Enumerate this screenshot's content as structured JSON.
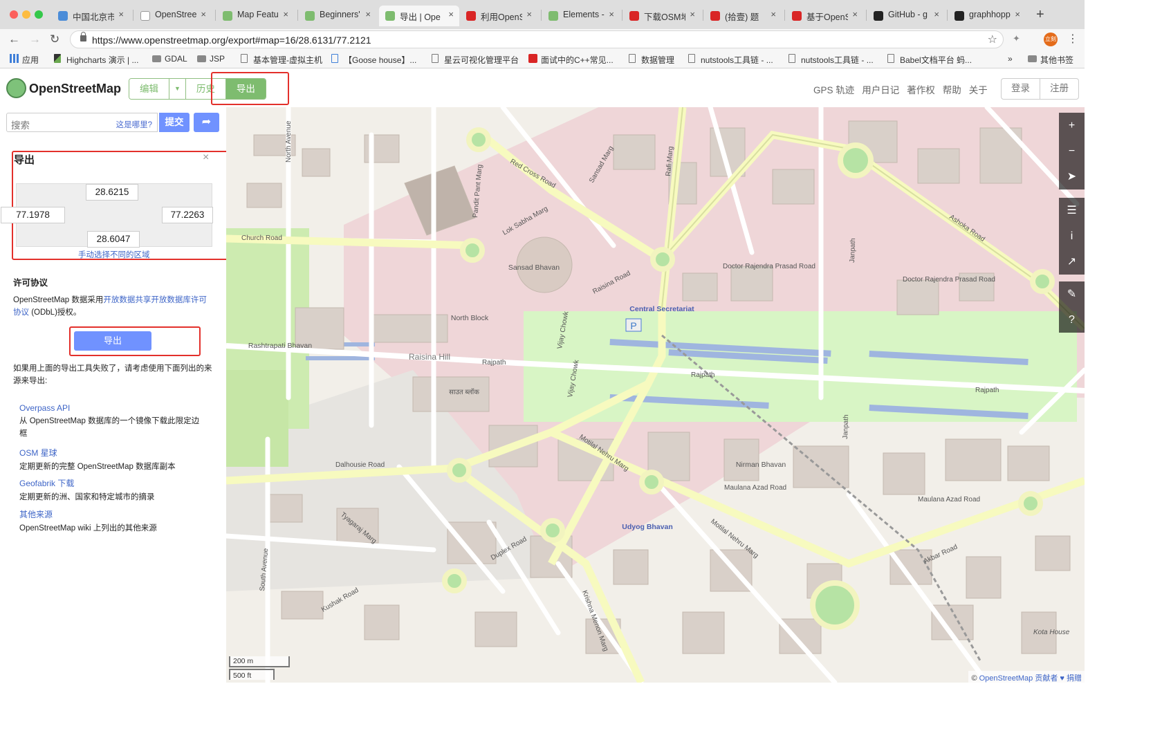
{
  "browser": {
    "tabs": [
      {
        "label": "中国北京市",
        "fav": "#4a8cd8"
      },
      {
        "label": "OpenStree",
        "fav": "#ffffff"
      },
      {
        "label": "Map Featur",
        "fav": "#7ebc6f"
      },
      {
        "label": "Beginners'",
        "fav": "#7ebc6f"
      },
      {
        "label": "导出 | Ope",
        "fav": "#7ebc6f"
      },
      {
        "label": "利用OpenS",
        "fav": "#d92525"
      },
      {
        "label": "Elements -",
        "fav": "#7ebc6f"
      },
      {
        "label": "下载OSM地",
        "fav": "#d92525"
      },
      {
        "label": "(拾壹) 题",
        "fav": "#d92525"
      },
      {
        "label": "基于OpenS",
        "fav": "#d92525"
      },
      {
        "label": "GitHub - g",
        "fav": "#222222"
      },
      {
        "label": "graphhopp",
        "fav": "#222222"
      }
    ],
    "active_tab": 4,
    "url": "https://www.openstreetmap.org/export#map=16/28.6131/77.2121",
    "avatar_text": "立刻",
    "bookmarks": [
      {
        "label": "应用",
        "icon": "apps-grid-icon"
      },
      {
        "label": "Highcharts 演示 | ...",
        "icon": "highcharts-icon"
      },
      {
        "label": "GDAL",
        "icon": "folder-icon"
      },
      {
        "label": "JSP",
        "icon": "folder-icon"
      },
      {
        "label": "基本管理-虚拟主机",
        "icon": "page-icon"
      },
      {
        "label": "【Goose house】...",
        "icon": "calendar-icon"
      },
      {
        "label": "星云可视化管理平台",
        "icon": "page-icon"
      },
      {
        "label": "面试中的C++常见...",
        "icon": "csdn-icon"
      },
      {
        "label": "数据管理",
        "icon": "page-icon"
      },
      {
        "label": "nutstools工具链 - ...",
        "icon": "page-icon"
      },
      {
        "label": "nutstools工具链 - ...",
        "icon": "page-icon"
      },
      {
        "label": "Babel文档平台 蚂...",
        "icon": "page-icon"
      }
    ],
    "bookmarks_more": "»",
    "other_bookmarks": "其他书签"
  },
  "osm": {
    "logo_text": "OpenStreetMap",
    "edit_label": "编辑",
    "history_label": "历史",
    "export_label": "导出",
    "nav_links": [
      "GPS 轨迹",
      "用户日记",
      "著作权",
      "帮助",
      "关于"
    ],
    "login_label": "登录",
    "signup_label": "注册",
    "accent_color": "#7ebc6f"
  },
  "sidebar": {
    "search_placeholder": "搜索",
    "where_is_this": "这是哪里?",
    "submit_label": "提交",
    "export_title": "导出",
    "bbox": {
      "north": "28.6215",
      "west": "77.1978",
      "east": "77.2263",
      "south": "28.6047"
    },
    "manual_select": "手动选择不同的区域",
    "license_heading": "许可协议",
    "license_prefix": "OpenStreetMap 数据采用",
    "license_link": "开放数据共享开放数据库许可协议",
    "license_suffix": " (ODbL)授权。",
    "export_button": "导出",
    "fallback_text": "如果用上面的导出工具失败了，请考虑使用下面列出的来源来导出:",
    "sources": [
      {
        "name": "Overpass API",
        "desc": "从 OpenStreetMap 数据库的一个镜像下载此限定边框"
      },
      {
        "name": "OSM 星球",
        "desc": "定期更新的完整 OpenStreetMap 数据库副本"
      },
      {
        "name": "Geofabrik 下载",
        "desc": "定期更新的洲、国家和特定城市的摘录"
      },
      {
        "name": "其他来源",
        "desc": "OpenStreetMap wiki 上列出的其他来源"
      }
    ]
  },
  "map": {
    "scale_metric": "200 m",
    "scale_imperial": "500 ft",
    "attribution_prefix": "© ",
    "attribution_link": "OpenStreetMap 贡献者",
    "attribution_donate": " ♥ 捐赠",
    "labels": {
      "sansad_bhavan": "Sansad Bhavan",
      "central_secretariat": "Central Secretariat",
      "rashtrapati_bhavan": "Rashtrapati Bhavan",
      "raisina_hill": "Raisina Hill",
      "north_block": "North Block",
      "nirman_bhavan": "Nirman Bhavan",
      "udyog_bhavan": "Udyog Bhavan",
      "rajpath": "Rajpath",
      "dalhousie_road": "Dalhousie Road",
      "church_road": "Church Road",
      "ashoka_road": "Ashoka Road",
      "raisina_road": "Raisina Road",
      "maulana_azad_road": "Maulana Azad Road",
      "dr_rajendra_prasad_road": "Doctor Rajendra Prasad Road",
      "vijay_chowk": "Vijay Chowk",
      "motilal_nehru_marg": "Motilal Nehru Marg",
      "krishna_menon_marg": "Krishna Menon Marg",
      "janpath": "Janpath",
      "rafi_marg": "Rafi Marg",
      "akbar_road": "Akbar Road",
      "red_cross_road": "Red Cross Road",
      "south_avenue": "South Avenue",
      "north_avenue": "North Avenue",
      "lok_sabha_marg": "Lok Sabha Marg",
      "sansad_marg": "Sansad Marg",
      "pandit_pant_marg": "Pandit Pant Marg",
      "duplex_road": "Duplex Road",
      "kushak_road": "Kushak Road",
      "tyagaraj_marg": "Tyagaraj Marg",
      "kota_house": "Kota House",
      "raj_block": "साउत ब्लॉक",
      "parking": "P"
    }
  }
}
